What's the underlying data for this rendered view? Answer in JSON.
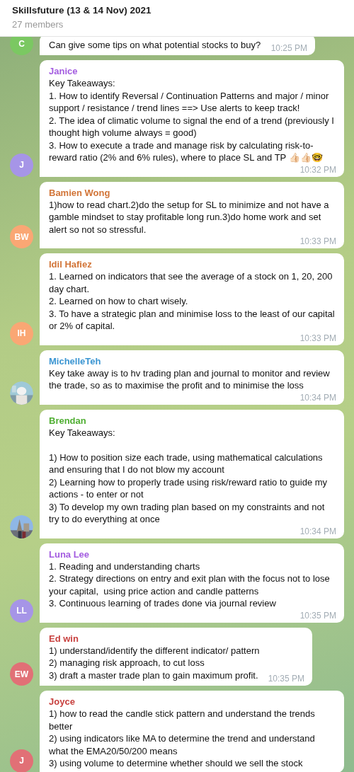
{
  "header": {
    "title": "Skillsfuture (13 & 14 Nov) 2021",
    "subtitle": "27 members"
  },
  "messages": [
    {
      "avatar": {
        "kind": "initials",
        "initials": "C",
        "color": "#7bc862"
      },
      "text": "Can give some tips on what potential stocks to buy?",
      "time": "10:25 PM"
    },
    {
      "sender": "Janice",
      "color": "#a35ce0",
      "avatar": {
        "kind": "initials",
        "initials": "J",
        "color": "#a695e7"
      },
      "text": "Key Takeaways:\n1. How to identify Reversal / Continuation Patterns and major / minor support / resistance / trend lines ==> Use alerts to keep track!\n2. The idea of climatic volume to signal the end of a trend (previously I thought high volume always = good)\n3. How to execute a trade and manage risk by calculating risk-to-reward ratio (2% and 6% rules), where to place SL and TP 👍🏻👍🏻🤓",
      "time": "10:32 PM"
    },
    {
      "sender": "Bamien Wong",
      "color": "#d27538",
      "avatar": {
        "kind": "initials",
        "initials": "BW",
        "color": "#faa774"
      },
      "text": "1)how to read chart.2)do the setup for SL to minimize and not have a gamble mindset to stay profitable long run.3)do home work and set alert so not so stressful.",
      "time": "10:33 PM"
    },
    {
      "sender": "Idil Hafiez",
      "color": "#d27538",
      "avatar": {
        "kind": "initials",
        "initials": "IH",
        "color": "#faa774"
      },
      "text": "1. Learned on indicators that see the average of a stock on 1, 20, 200 day chart.\n2. Learned on how to chart wisely.\n3. To have a strategic plan and minimise loss to the least of our capital or 2% of capital.",
      "time": "10:33 PM"
    },
    {
      "sender": "MichelleTeh",
      "color": "#3a95d2",
      "text": "Key take away is to hv trading plan and journal to monitor and review the trade, so as to maximise the profit and to minimise the loss",
      "time": "10:34 PM"
    },
    {
      "sender": "Brendan",
      "color": "#4fae32",
      "text": "Key Takeaways:\n\n1) How to position size each trade, using mathematical calculations and ensuring that I do not blow my account\n2) Learning how to properly trade using risk/reward ratio to guide my actions - to enter or not\n3) To develop my own trading plan based on my constraints and not try to do everything at once",
      "time": "10:34 PM"
    },
    {
      "sender": "Luna Lee",
      "color": "#a35ce0",
      "avatar": {
        "kind": "initials",
        "initials": "LL",
        "color": "#a695e7"
      },
      "text": "1. Reading and understanding charts\n2. Strategy directions on entry and exit plan with the focus not to lose your capital,  using price action and candle patterns\n3. Continuous learning of trades done via journal review",
      "time": "10:35 PM"
    },
    {
      "sender": "Ed win",
      "color": "#c8413f",
      "avatar": {
        "kind": "initials",
        "initials": "EW",
        "color": "#e17076"
      },
      "text": "1) understand/identify the different indicator/ pattern\n2) managing risk approach, to cut loss\n3) draft a master trade plan to gain maximum profit.",
      "time": "10:35 PM"
    },
    {
      "sender": "Joyce",
      "color": "#c8413f",
      "avatar": {
        "kind": "initials",
        "initials": "J",
        "color": "#e17076"
      },
      "text": "1) how to read the candle stick pattern and understand the trends better\n2) using indicators like MA to determine the trend and understand what the EMA20/50/200 means\n3) using volume to determine whether should we sell the stock"
    }
  ]
}
